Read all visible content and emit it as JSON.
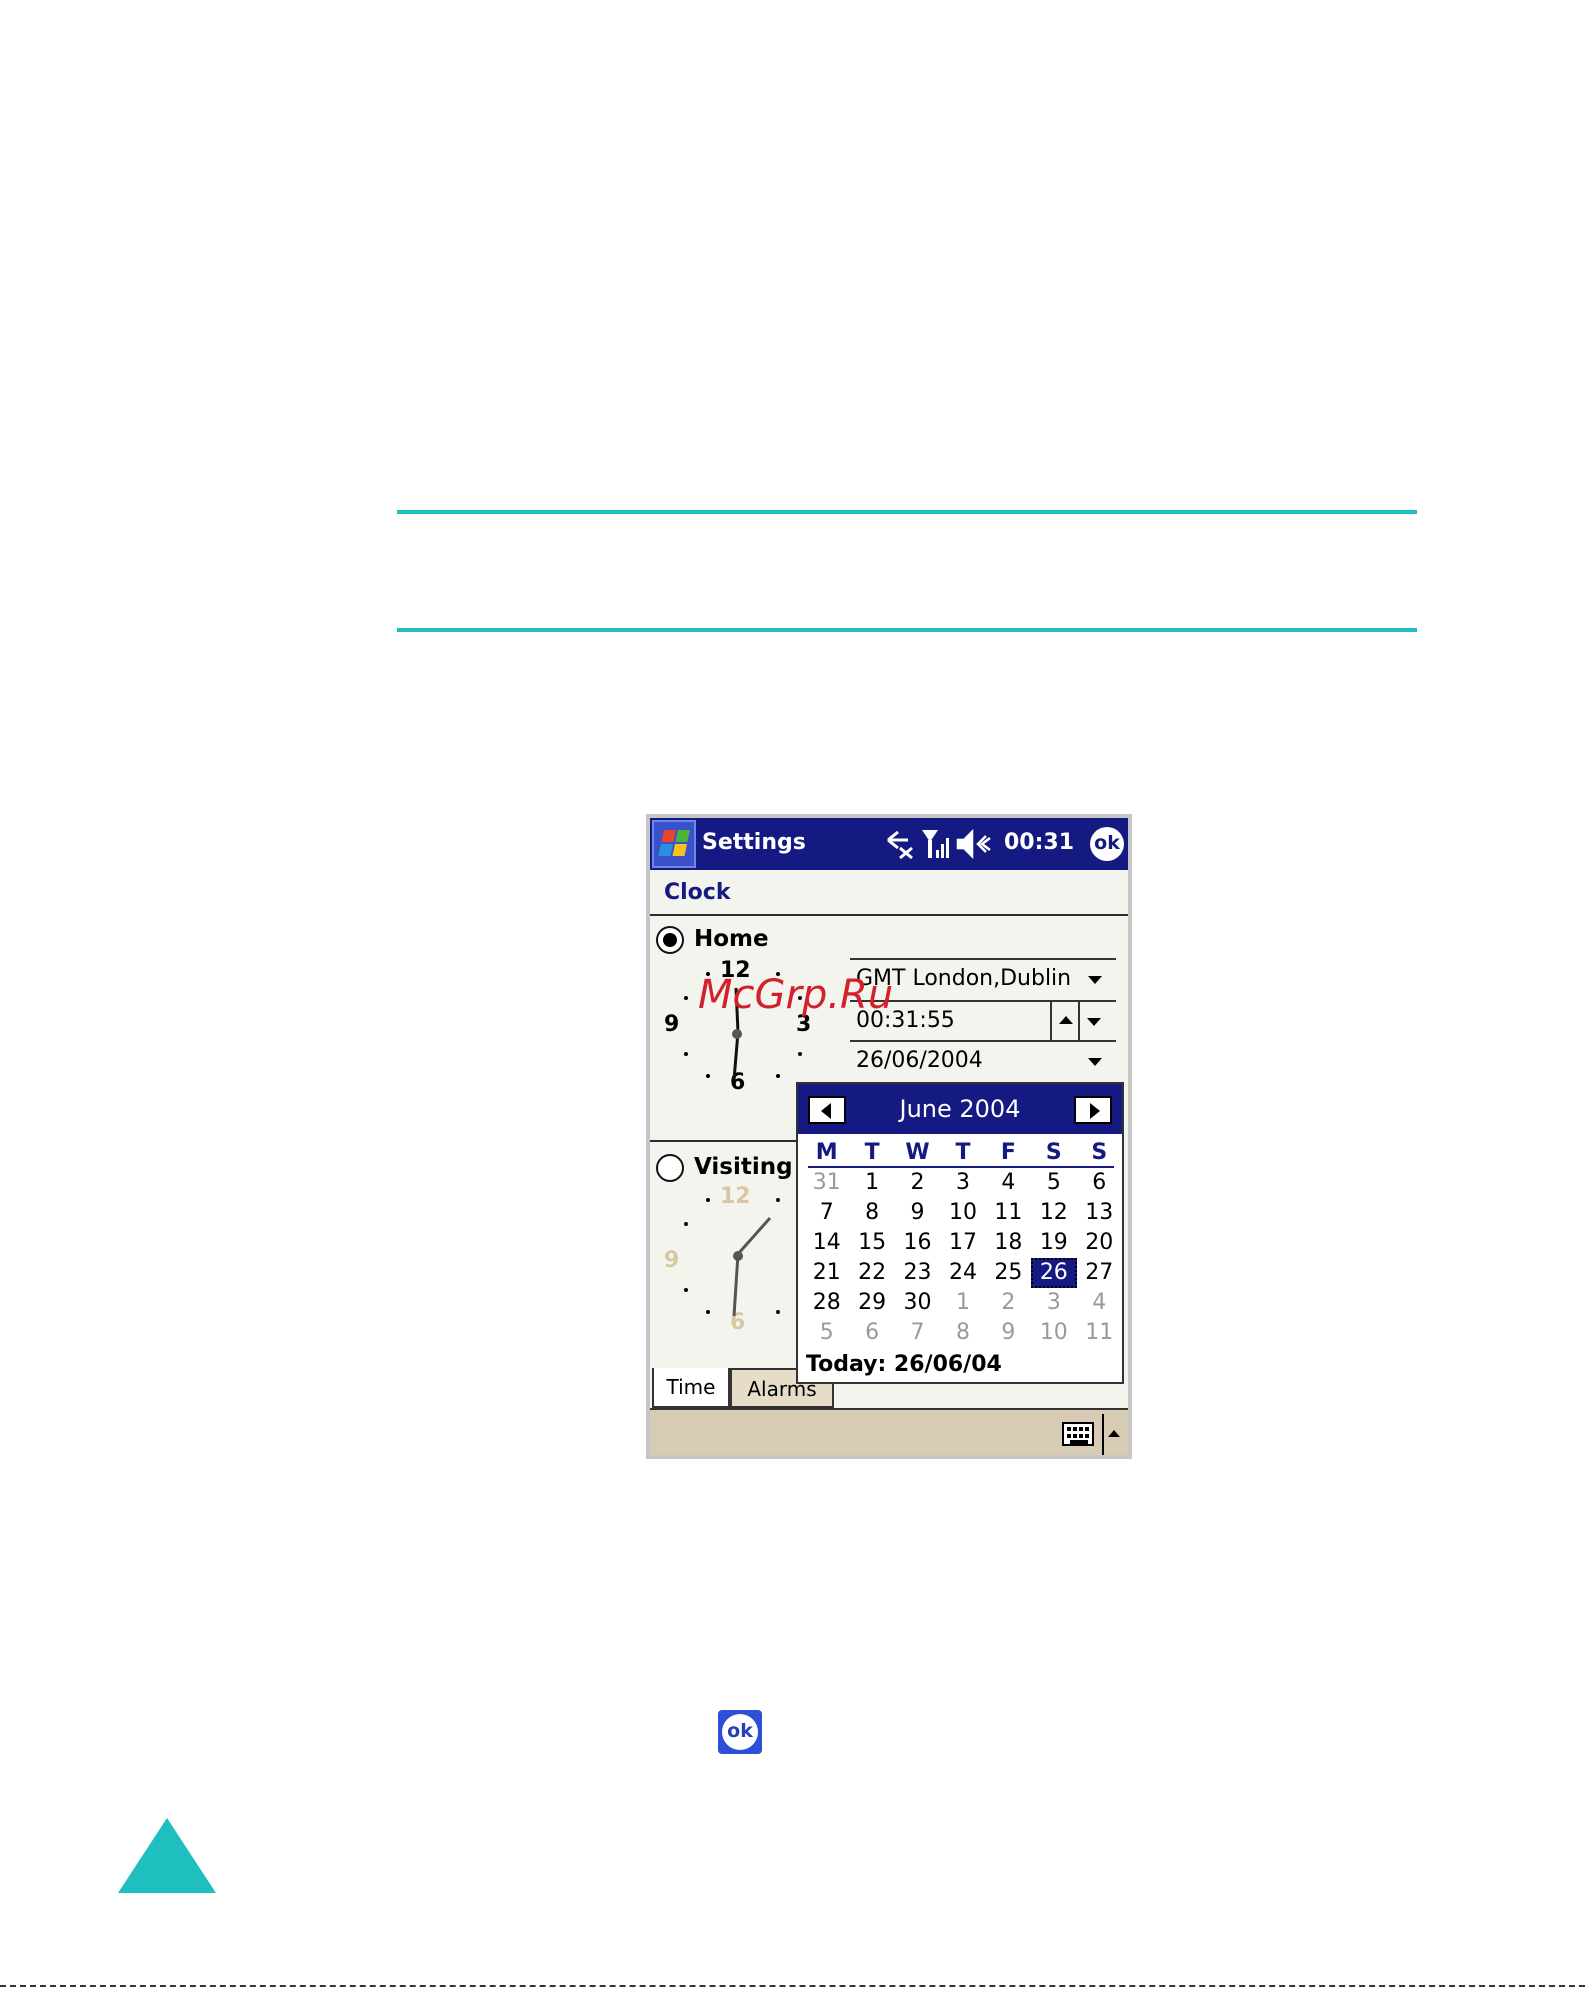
{
  "window": {
    "app_title": "Settings",
    "time": "00:31",
    "ok_label": "ok"
  },
  "page": {
    "title": "Clock"
  },
  "home": {
    "label": "Home",
    "selected": true,
    "timezone": "GMT London,Dublin",
    "time_value": "00:31:55",
    "date_value": "26/06/2004",
    "clock_numbers": [
      "12",
      "3",
      "6",
      "9"
    ]
  },
  "visiting": {
    "label": "Visiting",
    "selected": false,
    "clock_numbers": [
      "12",
      "6",
      "9"
    ]
  },
  "calendar": {
    "month_label": "June 2004",
    "weekdays": [
      "M",
      "T",
      "W",
      "T",
      "F",
      "S",
      "S"
    ],
    "weeks": [
      [
        "31",
        "1",
        "2",
        "3",
        "4",
        "5",
        "6"
      ],
      [
        "7",
        "8",
        "9",
        "10",
        "11",
        "12",
        "13"
      ],
      [
        "14",
        "15",
        "16",
        "17",
        "18",
        "19",
        "20"
      ],
      [
        "21",
        "22",
        "23",
        "24",
        "25",
        "26",
        "27"
      ],
      [
        "28",
        "29",
        "30",
        "1",
        "2",
        "3",
        "4"
      ],
      [
        "5",
        "6",
        "7",
        "8",
        "9",
        "10",
        "11"
      ]
    ],
    "selected_day": "26",
    "today_label": "Today: 26/06/04"
  },
  "tabs": [
    "Time",
    "Alarms"
  ],
  "watermark": "McGrp.Ru",
  "ok_icon_label": "ok",
  "colors": {
    "accent": "#1fbfbf",
    "titlebar": "#141a82"
  }
}
